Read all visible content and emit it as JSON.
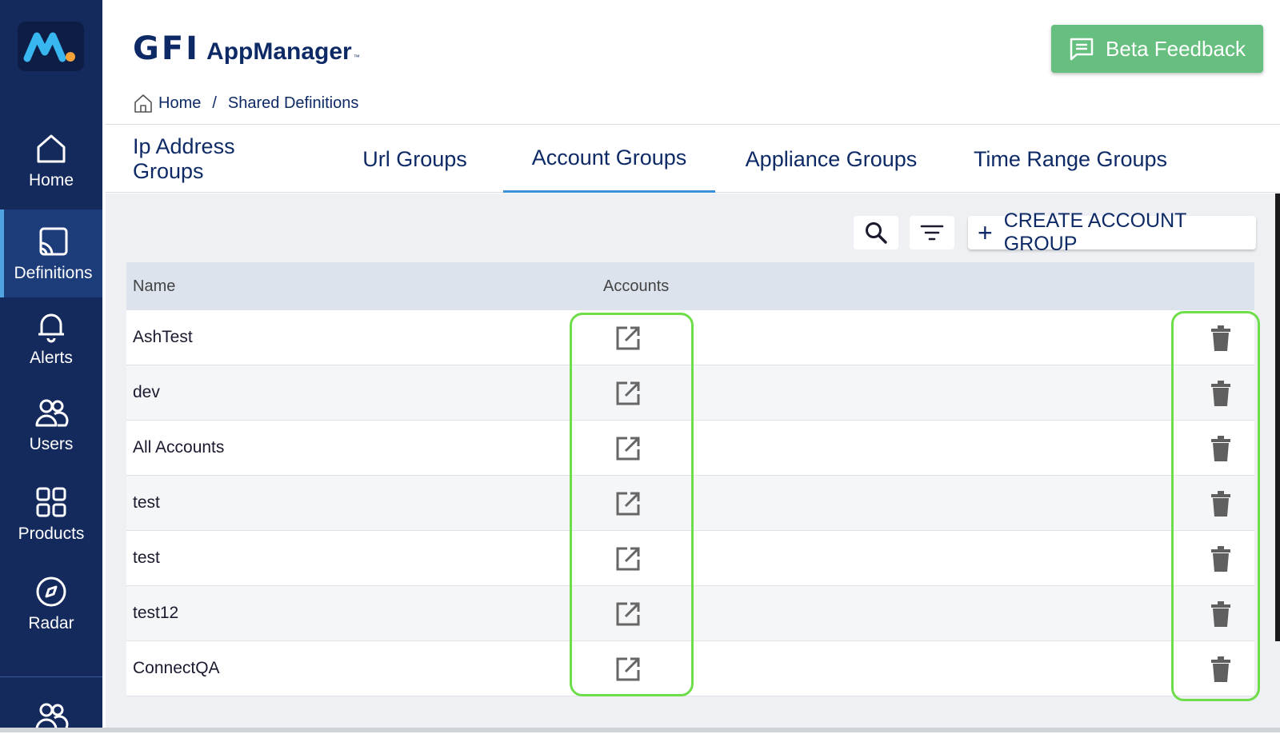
{
  "app": {
    "brand_gfi": "GFI",
    "brand_app": "AppManager",
    "brand_tm": "™"
  },
  "sidebar": {
    "items": [
      {
        "label": "Home",
        "icon": "home-icon"
      },
      {
        "label": "Definitions",
        "icon": "cast-icon",
        "active": true
      },
      {
        "label": "Alerts",
        "icon": "bell-icon"
      },
      {
        "label": "Users",
        "icon": "users-icon"
      },
      {
        "label": "Products",
        "icon": "grid-icon"
      },
      {
        "label": "Radar",
        "icon": "compass-icon"
      }
    ]
  },
  "header": {
    "feedback_label": "Beta Feedback"
  },
  "breadcrumb": {
    "home": "Home",
    "separator": "/",
    "current": "Shared Definitions"
  },
  "tabs": [
    {
      "label": "Ip Address Groups"
    },
    {
      "label": "Url Groups"
    },
    {
      "label": "Account Groups",
      "active": true
    },
    {
      "label": "Appliance Groups"
    },
    {
      "label": "Time Range Groups"
    }
  ],
  "toolbar": {
    "create_label": "CREATE ACCOUNT GROUP"
  },
  "table": {
    "columns": [
      "Name",
      "Accounts"
    ],
    "rows": [
      {
        "name": "AshTest"
      },
      {
        "name": "dev"
      },
      {
        "name": "All Accounts"
      },
      {
        "name": "test"
      },
      {
        "name": "test"
      },
      {
        "name": "test12"
      },
      {
        "name": "ConnectQA"
      }
    ]
  },
  "colors": {
    "sidebar_bg": "#142a5c",
    "brand_navy": "#0e2a66",
    "feedback_green": "#66bf7f",
    "tab_active": "#3a8fd9",
    "highlight": "#6ddd4a"
  }
}
